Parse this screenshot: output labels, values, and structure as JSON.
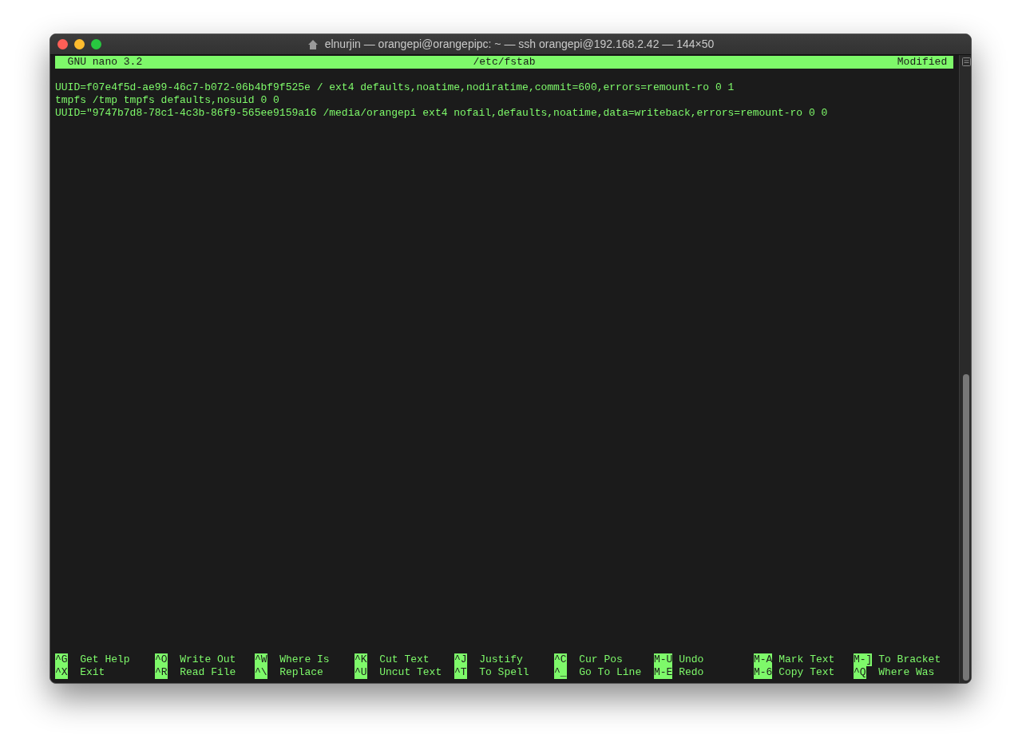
{
  "window": {
    "title": "elnurjin — orangepi@orangepipc: ~ — ssh orangepi@192.168.2.42 — 144×50"
  },
  "header": {
    "app": "GNU nano 3.2",
    "filename": "/etc/fstab",
    "status": "Modified"
  },
  "lines": [
    "UUID=f07e4f5d-ae99-46c7-b072-06b4bf9f525e / ext4 defaults,noatime,nodiratime,commit=600,errors=remount-ro 0 1",
    "tmpfs /tmp tmpfs defaults,nosuid 0 0",
    "UUID=\"9747b7d8-78c1-4c3b-86f9-565ee9159a16 /media/orangepi ext4 nofail,defaults,noatime,data=writeback,errors=remount-ro 0 0"
  ],
  "shortcuts": [
    [
      {
        "key": "^G",
        "label": "Get Help"
      },
      {
        "key": "^O",
        "label": "Write Out"
      },
      {
        "key": "^W",
        "label": "Where Is"
      },
      {
        "key": "^K",
        "label": "Cut Text"
      },
      {
        "key": "^J",
        "label": "Justify"
      },
      {
        "key": "^C",
        "label": "Cur Pos"
      },
      {
        "key": "M-U",
        "label": "Undo"
      },
      {
        "key": "M-A",
        "label": "Mark Text"
      },
      {
        "key": "M-]",
        "label": "To Bracket"
      }
    ],
    [
      {
        "key": "^X",
        "label": "Exit"
      },
      {
        "key": "^R",
        "label": "Read File"
      },
      {
        "key": "^\\",
        "label": "Replace"
      },
      {
        "key": "^U",
        "label": "Uncut Text"
      },
      {
        "key": "^T",
        "label": "To Spell"
      },
      {
        "key": "^_",
        "label": "Go To Line"
      },
      {
        "key": "M-E",
        "label": "Redo"
      },
      {
        "key": "M-6",
        "label": "Copy Text"
      },
      {
        "key": "^Q",
        "label": "Where Was"
      }
    ]
  ]
}
